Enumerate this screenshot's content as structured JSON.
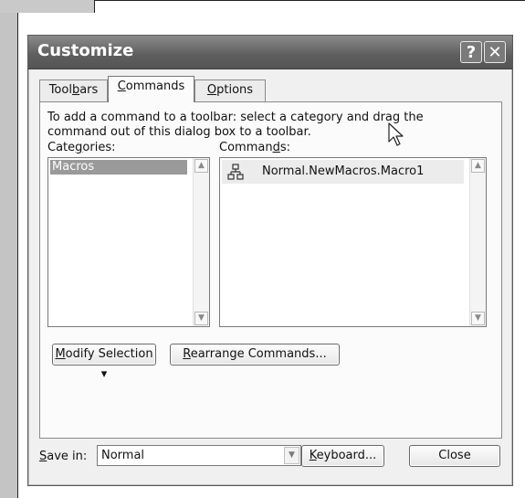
{
  "dialog": {
    "title": "Customize",
    "help_button": "?",
    "close_x": "✕"
  },
  "tabs": [
    {
      "label_pre": "Tool",
      "label_key": "b",
      "label_post": "ars"
    },
    {
      "label_pre": "",
      "label_key": "C",
      "label_post": "ommands"
    },
    {
      "label_pre": "",
      "label_key": "O",
      "label_post": "ptions"
    }
  ],
  "instructions": "To add a command to a toolbar: select a category and drag the command out of this dialog box to a toolbar.",
  "categories": {
    "label_pre": "Cate",
    "label_key": "g",
    "label_post": "ories:",
    "items": [
      "Macros"
    ]
  },
  "commands": {
    "label_pre": "Comman",
    "label_key": "d",
    "label_post": "s:",
    "items": [
      "Normal.NewMacros.Macro1"
    ]
  },
  "buttons": {
    "modify_pre": "",
    "modify_key": "M",
    "modify_post": "odify Selection",
    "modify_arrow": "▾",
    "rearrange_pre": "",
    "rearrange_key": "R",
    "rearrange_post": "earrange Commands...",
    "keyboard_pre": "",
    "keyboard_key": "K",
    "keyboard_post": "eyboard...",
    "close": "Close"
  },
  "save_in": {
    "label_pre": "",
    "label_key": "S",
    "label_post": "ave in:",
    "value": "Normal"
  }
}
